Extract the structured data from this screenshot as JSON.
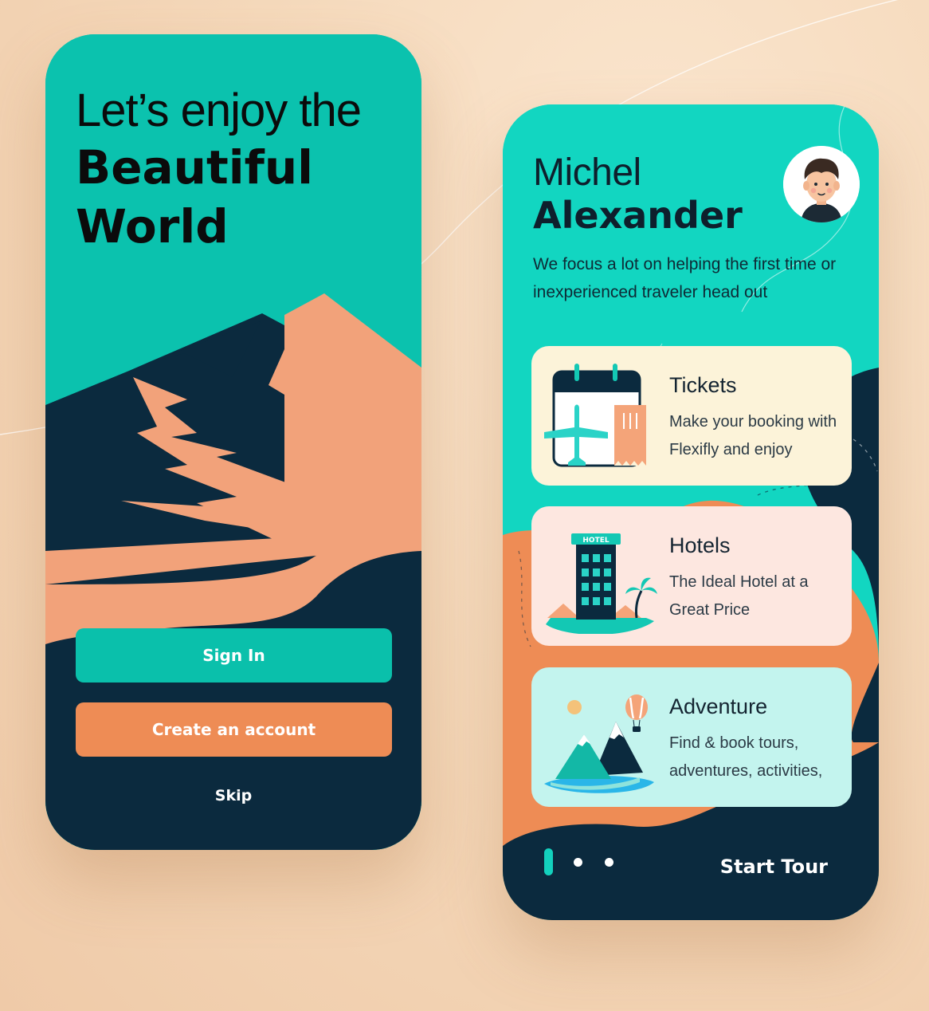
{
  "colors": {
    "teal": "#0ac0ab",
    "teal_light": "#12d6c1",
    "orange": "#ee8c55",
    "navy": "#0b2a3e",
    "peach": "#f4a479"
  },
  "onboarding": {
    "headline_line1": "Let’s enjoy the",
    "headline_line2": "Beautiful",
    "headline_line3": "World",
    "signin_label": "Sign In",
    "create_label": "Create an account",
    "skip_label": "Skip"
  },
  "profile": {
    "first_name": "Michel",
    "last_name": "Alexander",
    "description": "We focus a lot on helping the first time or inexperienced traveler head out",
    "cards": [
      {
        "title": "Tickets",
        "description": "Make your booking with Flexifly and enjoy",
        "icon": "calendar-plane-icon"
      },
      {
        "title": "Hotels",
        "description": "The Ideal Hotel at a Great Price",
        "icon": "hotel-building-icon",
        "sign": "HOTEL"
      },
      {
        "title": "Adventure",
        "description": "Find & book tours, adventures, activities,",
        "icon": "mountain-balloon-icon"
      }
    ],
    "pagination": {
      "total": 3,
      "active": 1
    },
    "start_tour_label": "Start Tour"
  }
}
